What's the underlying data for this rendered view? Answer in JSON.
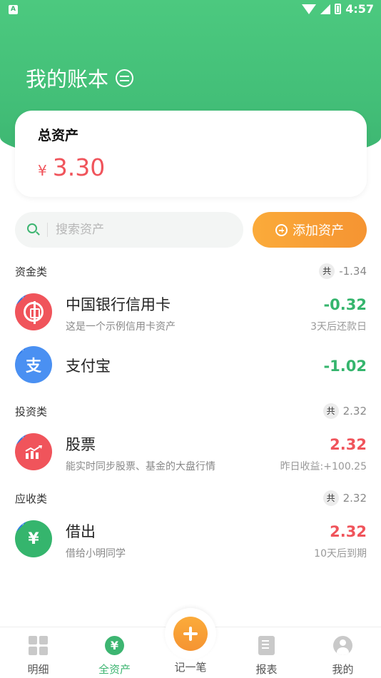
{
  "status_bar": {
    "left_badge": "A",
    "time": "4:57"
  },
  "header": {
    "title": "我的账本"
  },
  "summary": {
    "label": "总资产",
    "currency": "¥",
    "value": "3.30"
  },
  "search": {
    "placeholder": "搜索资产"
  },
  "add_button": {
    "label": "添加资产"
  },
  "sections": [
    {
      "title": "资金类",
      "total_badge": "共",
      "total": "-1.34",
      "items": [
        {
          "name": "中国银行信用卡",
          "subtitle": "这是一个示例信用卡资产",
          "value": "-0.32",
          "note": "3天后还款日",
          "tag": "示例",
          "icon": "bank-of-china-icon",
          "color": "#f0545b"
        },
        {
          "name": "支付宝",
          "subtitle": "",
          "value": "-1.02",
          "note": "",
          "tag": "示例",
          "icon_glyph": "支",
          "icon": "alipay-icon",
          "color": "#4a90f2"
        }
      ]
    },
    {
      "title": "投资类",
      "total_badge": "共",
      "total": "2.32",
      "items": [
        {
          "name": "股票",
          "subtitle": "能实时同步股票、基金的大盘行情",
          "value": "2.32",
          "note": "昨日收益:+100.25",
          "tag": "示例",
          "icon": "stock-chart-icon",
          "color": "#f0545b"
        }
      ]
    },
    {
      "title": "应收类",
      "total_badge": "共",
      "total": "2.32",
      "items": [
        {
          "name": "借出",
          "subtitle": "借给小明同学",
          "value": "2.32",
          "note": "10天后到期",
          "tag": "示例",
          "icon_glyph": "¥",
          "icon": "lend-money-icon",
          "color": "#35b56d"
        }
      ]
    }
  ],
  "bottom_nav": {
    "items": [
      {
        "label": "明细"
      },
      {
        "label": "全资产",
        "icon_glyph": "¥"
      },
      {
        "label": "记一笔"
      },
      {
        "label": "报表"
      },
      {
        "label": "我的"
      }
    ]
  },
  "colors": {
    "primary_green": "#3db571",
    "accent_orange": "#f59432",
    "negative_red": "#f0545b"
  }
}
